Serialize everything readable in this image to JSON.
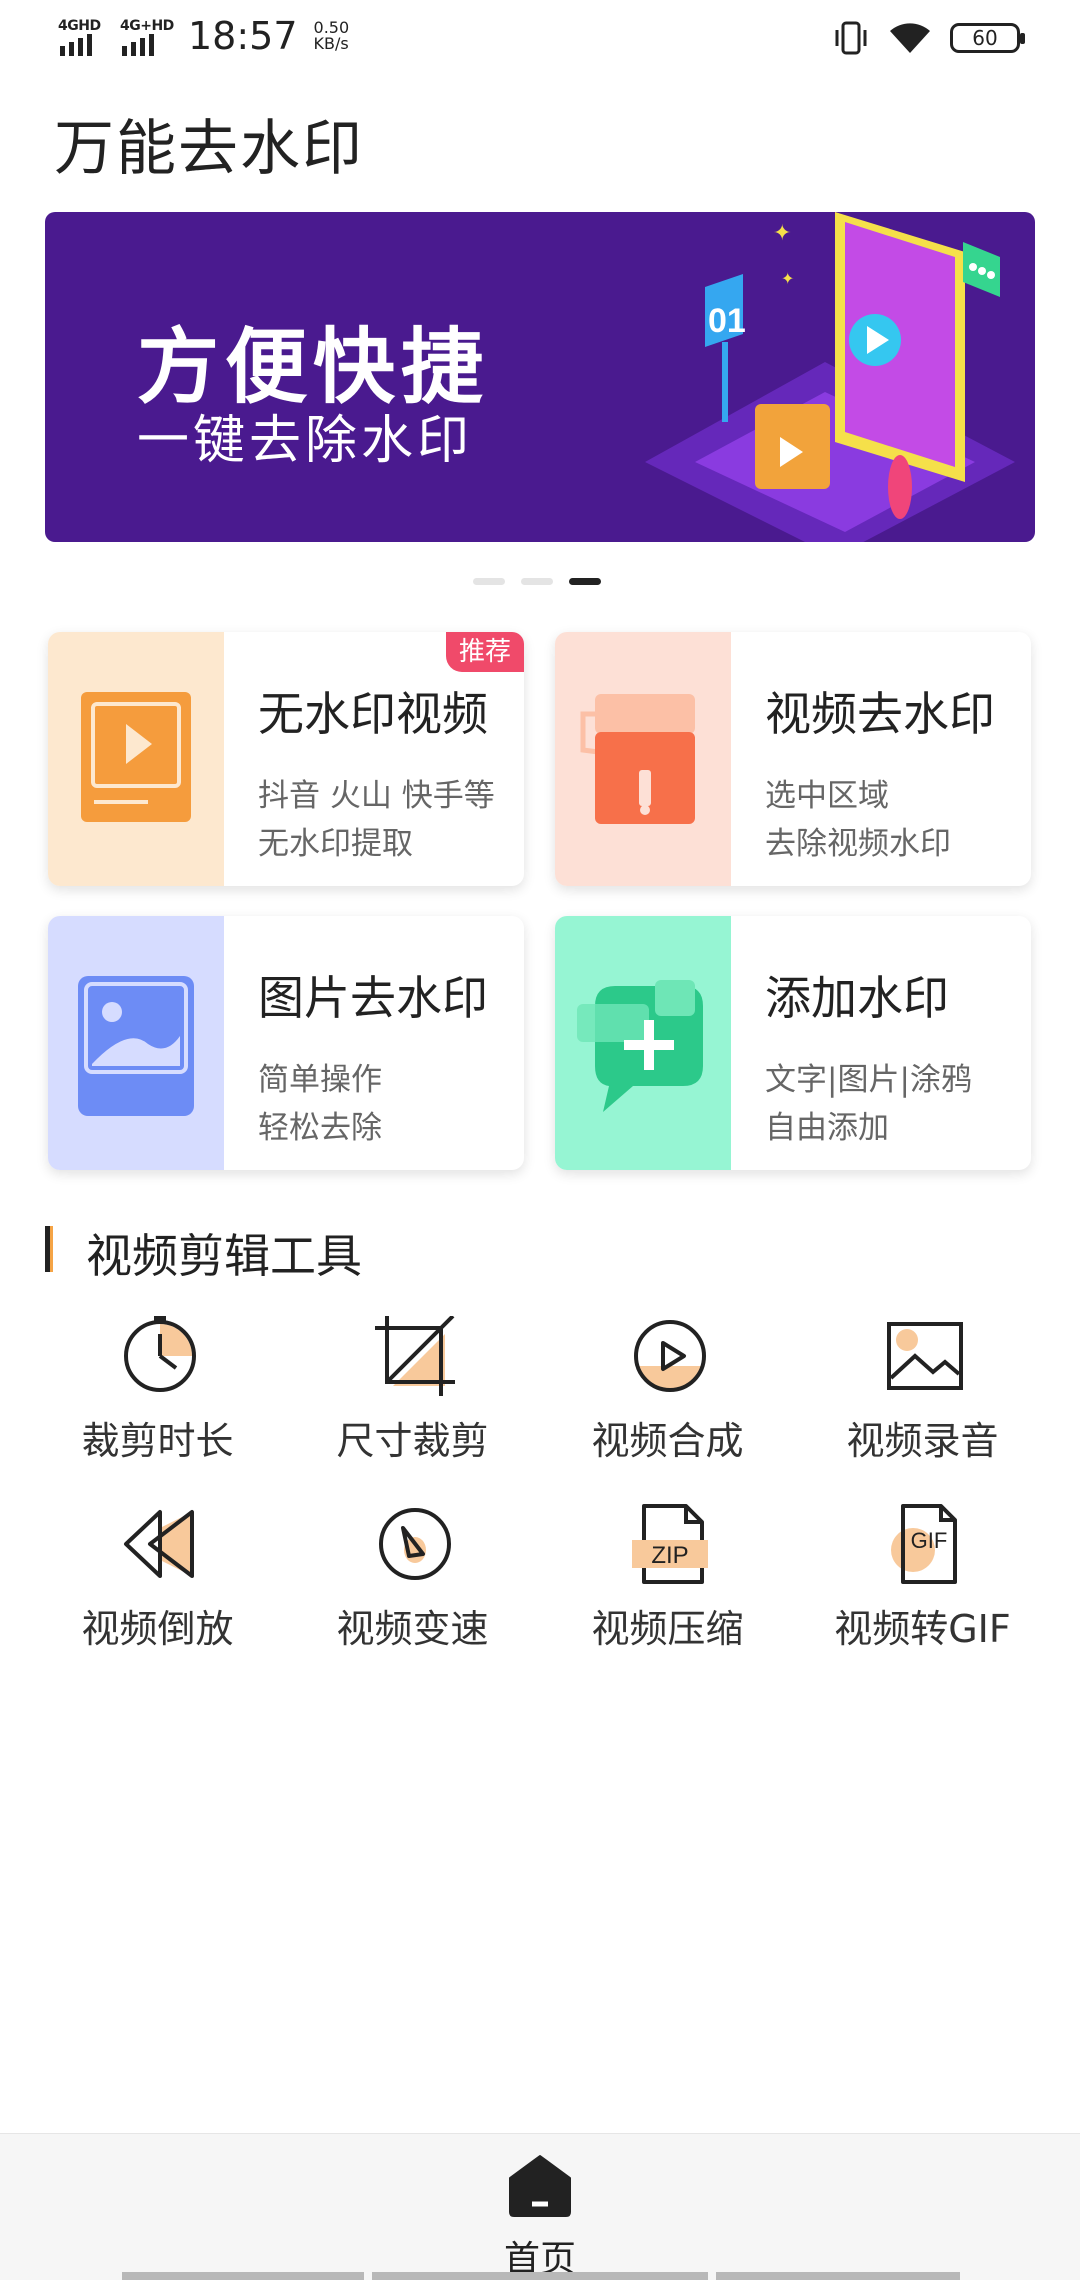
{
  "status_bar": {
    "network1": "4GHD",
    "network2": "4G+HD",
    "time": "18:57",
    "speed_value": "0.50",
    "speed_unit": "KB/s",
    "battery": "60"
  },
  "app_title": "万能去水印",
  "banner": {
    "line1": "方便快捷",
    "line2": "一键去除水印",
    "graphic_label": "01",
    "page_count": 3,
    "active_page": 3
  },
  "features": [
    {
      "title": "无水印视频",
      "desc1": "抖音 火山 快手等",
      "desc2": "无水印提取",
      "badge": "推荐",
      "color": "#fde8cf",
      "icon": "play-video-icon"
    },
    {
      "title": "视频去水印",
      "desc1": "选中区域",
      "desc2": "去除视频水印",
      "color": "#fde0d6",
      "icon": "paint-roller-icon"
    },
    {
      "title": "图片去水印",
      "desc1": "简单操作",
      "desc2": "轻松去除",
      "color": "#d6dcff",
      "icon": "image-icon"
    },
    {
      "title": "添加水印",
      "desc1": "文字|图片|涂鸦",
      "desc2": "自由添加",
      "color": "#96f5d3",
      "icon": "add-chat-icon"
    }
  ],
  "section_title": "视频剪辑工具",
  "tools": [
    {
      "label": "裁剪时长",
      "icon": "clock-icon"
    },
    {
      "label": "尺寸裁剪",
      "icon": "crop-icon"
    },
    {
      "label": "视频合成",
      "icon": "play-circle-icon"
    },
    {
      "label": "视频录音",
      "icon": "picture-icon"
    },
    {
      "label": "视频倒放",
      "icon": "rewind-icon"
    },
    {
      "label": "视频变速",
      "icon": "speed-icon"
    },
    {
      "label": "视频压缩",
      "icon": "zip-file-icon"
    },
    {
      "label": "视频转GIF",
      "icon": "gif-file-icon"
    }
  ],
  "tool_icon_texts": {
    "zip": "ZIP",
    "gif": "GIF"
  },
  "bottom_nav": {
    "home_label": "首页"
  },
  "colors": {
    "accent": "#f5a446",
    "banner": "#4a1a8f",
    "badge": "#f04a6a"
  }
}
